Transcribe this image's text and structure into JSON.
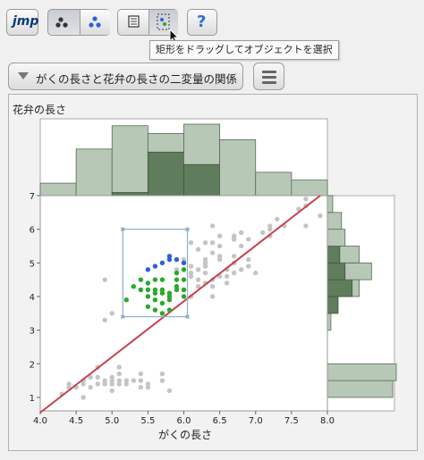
{
  "toolbar": {
    "jmp_logo": "jmp",
    "help_label": "?",
    "tooltip": "矩形をドラッグしてオブジェクトを選択"
  },
  "outline": {
    "title": "がくの長さと花弁の長さの二変量の関係",
    "menu_icon": "hamburger-menu-icon"
  },
  "colors": {
    "unselected": "#c4c4c4",
    "selected_blue": "#2f5fd8",
    "selected_green": "#2aa82a",
    "fit_line": "#c8404f",
    "hist_fill": "#b8c8b7",
    "hist_selected": "#5f7d5c",
    "brush": "#8fb0cc"
  },
  "chart_data": {
    "type": "scatter",
    "xlabel": "がくの長さ",
    "ylabel": "花弁の長さ",
    "xlim": [
      4.0,
      8.0
    ],
    "ylim": [
      0.6,
      7.0
    ],
    "x_ticks": [
      "4.0",
      "4.5",
      "5.0",
      "5.5",
      "6.0",
      "6.5",
      "7.0",
      "7.5",
      "8.0"
    ],
    "y_ticks": [
      "1",
      "2",
      "3",
      "4",
      "5",
      "6",
      "7"
    ],
    "fit_line": [
      [
        4.0,
        0.55
      ],
      [
        7.9,
        7.0
      ]
    ],
    "selection_rectangle": {
      "x": [
        5.15,
        6.05
      ],
      "y": [
        3.4,
        6.0
      ]
    },
    "series": [
      {
        "name": "unselected",
        "points": [
          [
            4.3,
            1.1
          ],
          [
            4.4,
            1.3
          ],
          [
            4.4,
            1.4
          ],
          [
            4.5,
            1.3
          ],
          [
            4.6,
            1.0
          ],
          [
            4.6,
            1.4
          ],
          [
            4.6,
            1.5
          ],
          [
            4.7,
            1.3
          ],
          [
            4.7,
            1.6
          ],
          [
            4.8,
            1.4
          ],
          [
            4.8,
            1.6
          ],
          [
            4.8,
            1.9
          ],
          [
            4.9,
            1.4
          ],
          [
            4.9,
            1.5
          ],
          [
            5.0,
            1.2
          ],
          [
            5.0,
            1.4
          ],
          [
            5.0,
            1.5
          ],
          [
            5.0,
            1.6
          ],
          [
            5.1,
            1.4
          ],
          [
            5.1,
            1.5
          ],
          [
            5.1,
            1.7
          ],
          [
            5.1,
            1.9
          ],
          [
            5.2,
            1.4
          ],
          [
            5.2,
            1.5
          ],
          [
            5.3,
            1.5
          ],
          [
            5.4,
            1.3
          ],
          [
            5.4,
            1.5
          ],
          [
            5.4,
            1.7
          ],
          [
            5.5,
            1.3
          ],
          [
            5.5,
            1.4
          ],
          [
            5.7,
            1.5
          ],
          [
            5.7,
            1.7
          ],
          [
            5.8,
            1.2
          ],
          [
            5.0,
            3.5
          ],
          [
            4.9,
            3.3
          ],
          [
            4.9,
            4.5
          ],
          [
            6.1,
            4.0
          ],
          [
            6.1,
            4.7
          ],
          [
            6.2,
            4.3
          ],
          [
            6.2,
            4.5
          ],
          [
            6.3,
            4.4
          ],
          [
            6.3,
            4.9
          ],
          [
            6.4,
            4.3
          ],
          [
            6.4,
            4.5
          ],
          [
            6.5,
            4.6
          ],
          [
            6.6,
            4.4
          ],
          [
            6.7,
            4.7
          ],
          [
            6.8,
            4.8
          ],
          [
            6.1,
            5.6
          ],
          [
            6.2,
            5.4
          ],
          [
            6.3,
            5.0
          ],
          [
            6.3,
            5.6
          ],
          [
            6.4,
            5.3
          ],
          [
            6.4,
            5.6
          ],
          [
            6.5,
            5.5
          ],
          [
            6.5,
            5.8
          ],
          [
            6.7,
            5.2
          ],
          [
            6.7,
            5.7
          ],
          [
            6.8,
            5.5
          ],
          [
            6.9,
            5.1
          ],
          [
            6.9,
            5.7
          ],
          [
            7.0,
            4.7
          ],
          [
            7.1,
            5.9
          ],
          [
            7.2,
            6.0
          ],
          [
            7.2,
            6.1
          ],
          [
            7.3,
            6.3
          ],
          [
            7.4,
            6.1
          ],
          [
            7.6,
            6.6
          ],
          [
            7.7,
            6.7
          ],
          [
            7.7,
            6.9
          ],
          [
            7.9,
            6.4
          ],
          [
            6.0,
            4.5
          ],
          [
            6.0,
            5.1
          ],
          [
            6.1,
            4.9
          ],
          [
            6.3,
            5.1
          ],
          [
            6.5,
            5.2
          ],
          [
            6.6,
            4.6
          ],
          [
            6.8,
            5.9
          ],
          [
            6.4,
            6.1
          ],
          [
            6.2,
            4.8
          ],
          [
            5.9,
            4.8
          ],
          [
            6.0,
            4.2
          ],
          [
            6.7,
            5.8
          ],
          [
            6.9,
            4.9
          ],
          [
            6.1,
            4.6
          ],
          [
            6.5,
            5.1
          ],
          [
            6.3,
            4.7
          ],
          [
            7.2,
            5.8
          ],
          [
            7.7,
            6.1
          ],
          [
            6.7,
            5.0
          ],
          [
            6.4,
            4.0
          ],
          [
            6.6,
            4.8
          ]
        ]
      },
      {
        "name": "selected-blue",
        "points": [
          [
            5.6,
            4.9
          ],
          [
            5.7,
            5.0
          ],
          [
            5.8,
            5.1
          ],
          [
            5.9,
            5.1
          ],
          [
            6.0,
            5.0
          ],
          [
            5.8,
            5.2
          ],
          [
            5.5,
            4.8
          ]
        ]
      },
      {
        "name": "selected-green",
        "points": [
          [
            5.2,
            3.9
          ],
          [
            5.4,
            4.5
          ],
          [
            5.5,
            4.0
          ],
          [
            5.5,
            4.2
          ],
          [
            5.5,
            4.4
          ],
          [
            5.6,
            3.9
          ],
          [
            5.6,
            4.2
          ],
          [
            5.6,
            4.1
          ],
          [
            5.6,
            4.5
          ],
          [
            5.7,
            3.5
          ],
          [
            5.7,
            4.1
          ],
          [
            5.7,
            4.2
          ],
          [
            5.8,
            3.9
          ],
          [
            5.8,
            4.0
          ],
          [
            5.8,
            4.1
          ],
          [
            5.9,
            4.2
          ],
          [
            5.9,
            4.3
          ],
          [
            5.9,
            4.7
          ],
          [
            6.0,
            4.0
          ],
          [
            6.0,
            4.5
          ],
          [
            5.3,
            4.3
          ],
          [
            5.4,
            4.2
          ],
          [
            5.5,
            3.7
          ],
          [
            5.7,
            3.8
          ],
          [
            5.8,
            3.6
          ],
          [
            6.0,
            4.2
          ],
          [
            5.7,
            4.5
          ],
          [
            6.0,
            4.8
          ],
          [
            5.6,
            3.6
          ],
          [
            5.9,
            4.5
          ]
        ]
      }
    ],
    "top_histogram": {
      "bins": [
        4.0,
        4.5,
        5.0,
        5.5,
        6.0,
        6.5,
        7.0,
        7.5,
        8.0
      ],
      "counts": [
        8,
        30,
        45,
        40,
        46,
        36,
        15,
        10
      ],
      "selected_counts": [
        0,
        0,
        2,
        28,
        20,
        0,
        0,
        0
      ]
    },
    "right_histogram": {
      "bins": [
        1.0,
        1.5,
        2.0,
        2.5,
        3.0,
        3.5,
        4.0,
        4.5,
        5.0,
        5.5,
        6.0,
        6.5,
        7.0
      ],
      "counts": [
        37,
        39,
        0,
        0,
        2,
        6,
        18,
        25,
        18,
        10,
        8,
        3
      ],
      "selected_counts": [
        0,
        0,
        0,
        0,
        0,
        6,
        14,
        10,
        7,
        0,
        0,
        0
      ]
    }
  }
}
